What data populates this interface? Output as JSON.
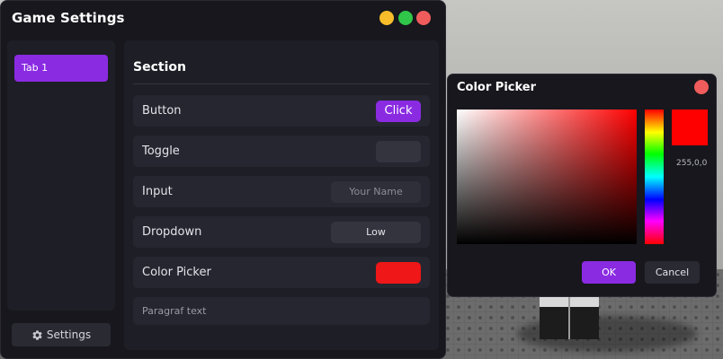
{
  "window": {
    "title": "Game Settings",
    "controls": [
      "minimize-icon",
      "maximize-icon",
      "close-icon"
    ]
  },
  "sidebar": {
    "tabs": [
      {
        "label": "Tab 1",
        "active": true
      }
    ],
    "settings_button": {
      "icon": "gear-icon",
      "label": "Settings"
    }
  },
  "section": {
    "title": "Section",
    "rows": [
      {
        "label": "Button",
        "control": "button",
        "button_label": "Click"
      },
      {
        "label": "Toggle",
        "control": "toggle",
        "on": false
      },
      {
        "label": "Input",
        "control": "input",
        "value": "",
        "placeholder": "Your Name"
      },
      {
        "label": "Dropdown",
        "control": "dropdown",
        "selected": "Low"
      },
      {
        "label": "Color Picker",
        "control": "color",
        "color": "#ef1717"
      }
    ],
    "paragraph": "Paragraf text"
  },
  "color_picker": {
    "title": "Color Picker",
    "rgb_text": "255,0,0",
    "selected_color": "#ff0000",
    "ok_label": "OK",
    "cancel_label": "Cancel"
  },
  "colors": {
    "accent": "#8a2be2",
    "window_bg": "#17171d",
    "panel_bg": "#1e1e26",
    "row_bg": "#262630",
    "close": "#f05c5c",
    "minimize": "#f7bd2a",
    "maximize": "#30c649"
  }
}
